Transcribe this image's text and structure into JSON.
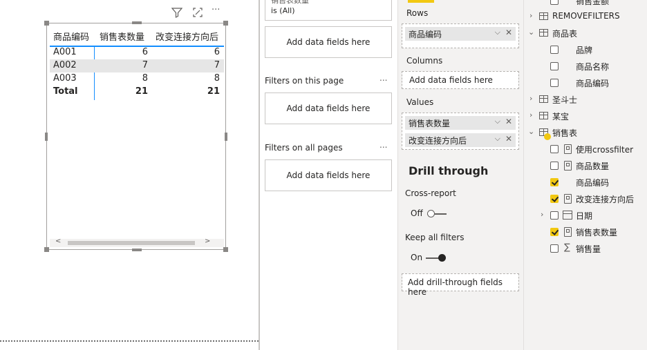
{
  "matrix": {
    "headers": [
      "商品编码",
      "销售表数量",
      "改变连接方向后"
    ],
    "rows": [
      {
        "code": "A001",
        "qty": "6",
        "qty2": "6"
      },
      {
        "code": "A002",
        "qty": "7",
        "qty2": "7"
      },
      {
        "code": "A003",
        "qty": "8",
        "qty2": "8"
      }
    ],
    "total": {
      "label": "Total",
      "qty": "21",
      "qty2": "21"
    }
  },
  "visual_header": {
    "filter_icon": "filter-icon",
    "focus_icon": "focus-mode-icon",
    "more": "···"
  },
  "filters": {
    "top_card": {
      "field": "销售表数量",
      "state": "is (All)"
    },
    "add_label": "Add data fields here",
    "this_page": "Filters on this page",
    "all_pages": "Filters on all pages",
    "more": "..."
  },
  "viz": {
    "rows_label": "Rows",
    "rows_field": "商品编码",
    "columns_label": "Columns",
    "columns_add": "Add data fields here",
    "values_label": "Values",
    "values_fields": [
      "销售表数量",
      "改变连接方向后"
    ],
    "drill_title": "Drill through",
    "cross_report": "Cross-report",
    "cross_state": "Off",
    "keep_filters": "Keep all filters",
    "keep_state": "On",
    "drill_add": "Add drill-through fields here",
    "chev": "⌵",
    "x": "✕"
  },
  "fields": {
    "partial_top": "销售金额",
    "tables": {
      "removefilters": "REMOVEFILTERS",
      "product": "商品表",
      "product_fields": [
        "品牌",
        "商品名称",
        "商品编码"
      ],
      "doudou": "圣斗士",
      "mou": "某宝",
      "sales": "销售表",
      "sales_fields": [
        {
          "name": "使用crossfilter",
          "checked": false,
          "type": "measure"
        },
        {
          "name": "商品数量",
          "checked": false,
          "type": "measure"
        },
        {
          "name": "商品编码",
          "checked": true,
          "type": "column"
        },
        {
          "name": "改变连接方向后",
          "checked": true,
          "type": "measure"
        },
        {
          "name": "日期",
          "checked": false,
          "type": "date"
        },
        {
          "name": "销售表数量",
          "checked": true,
          "type": "measure"
        },
        {
          "name": "销售量",
          "checked": false,
          "type": "sum"
        }
      ]
    }
  },
  "colors": {
    "accent": "#f2c811",
    "selection": "#118dff"
  }
}
